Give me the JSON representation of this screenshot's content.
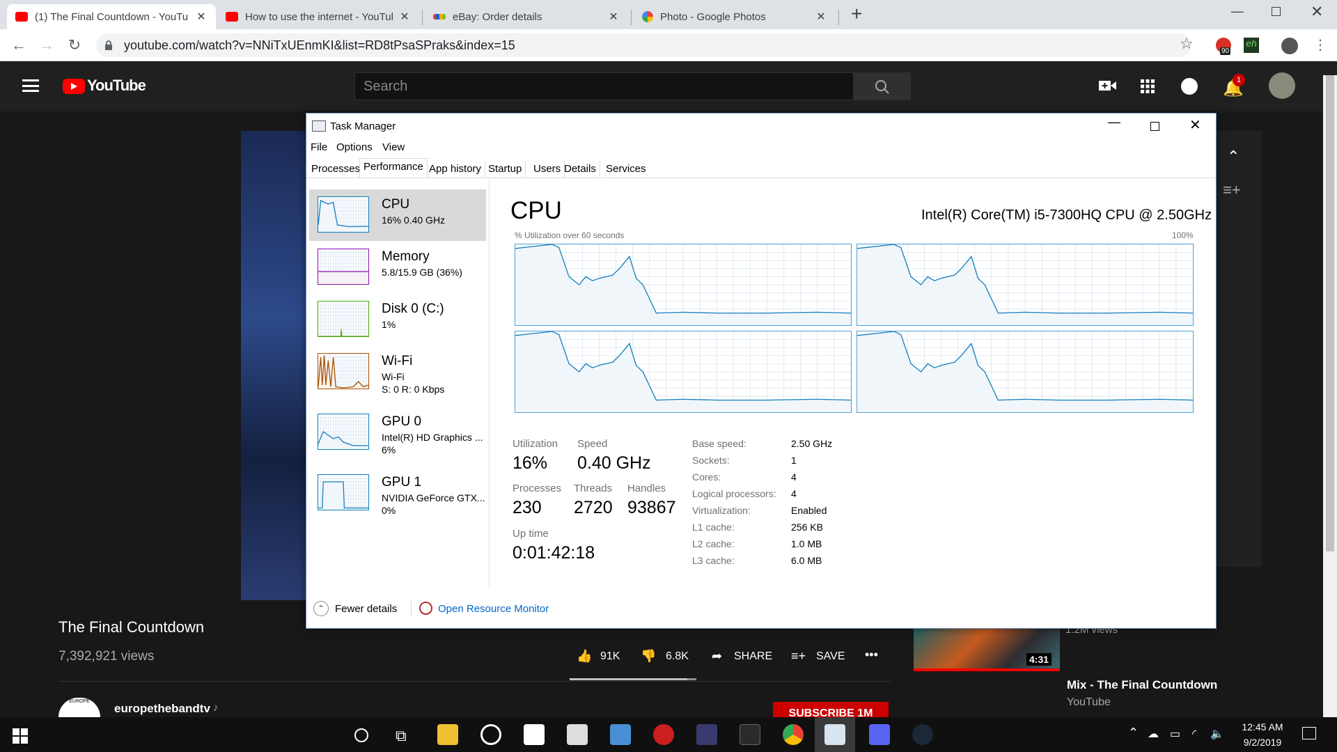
{
  "browser": {
    "tabs": [
      {
        "title": "(1) The Final Countdown - YouTu",
        "color": "#ff0000"
      },
      {
        "title": "How to use the internet - YouTub",
        "color": "#ff0000"
      },
      {
        "title": "eBay: Order details",
        "color": "#e53238"
      },
      {
        "title": "Photo - Google Photos",
        "color": "#fbbc05"
      }
    ],
    "new_tab": "+",
    "url": "youtube.com/watch?v=NNiTxUEnmKI&list=RD8tPsaSPraks&index=15",
    "ext_badge": "90",
    "ext_label": "eh"
  },
  "youtube": {
    "logo": "YouTube",
    "search_placeholder": "Search",
    "notif_count": "1",
    "video_title": "The Final Countdown",
    "views": "7,392,921 views",
    "likes": "91K",
    "dislikes": "6.8K",
    "share": "SHARE",
    "save": "SAVE",
    "channel": "europethebandtv",
    "channel_logo": "EUROPE",
    "subscribe": "SUBSCRIBE 1M",
    "side_views": "1.2M views",
    "side_duration": "4:31",
    "side_title": "Mix - The Final Countdown",
    "side_channel": "YouTube"
  },
  "taskmanager": {
    "title": "Task Manager",
    "menu": [
      "File",
      "Options",
      "View"
    ],
    "tabs": [
      "Processes",
      "Performance",
      "App history",
      "Startup",
      "Users",
      "Details",
      "Services"
    ],
    "active_tab": "Performance",
    "sidebar": [
      {
        "name": "CPU",
        "d1": "16% 0.40 GHz",
        "d2": "",
        "color": "#117dbb"
      },
      {
        "name": "Memory",
        "d1": "5.8/15.9 GB (36%)",
        "d2": "",
        "color": "#8b12ae"
      },
      {
        "name": "Disk 0 (C:)",
        "d1": "1%",
        "d2": "",
        "color": "#4da60c"
      },
      {
        "name": "Wi-Fi",
        "d1": "Wi-Fi",
        "d2": "S: 0 R: 0 Kbps",
        "color": "#a74f01"
      },
      {
        "name": "GPU 0",
        "d1": "Intel(R) HD Graphics ...",
        "d2": "6%",
        "color": "#117dbb"
      },
      {
        "name": "GPU 1",
        "d1": "NVIDIA GeForce GTX...",
        "d2": "0%",
        "color": "#117dbb"
      }
    ],
    "cpu": {
      "heading": "CPU",
      "model": "Intel(R) Core(TM) i5-7300HQ CPU @ 2.50GHz",
      "graph_label": "% Utilization over 60 seconds",
      "graph_max": "100%",
      "utilization_label": "Utilization",
      "utilization": "16%",
      "speed_label": "Speed",
      "speed": "0.40 GHz",
      "processes_label": "Processes",
      "processes": "230",
      "threads_label": "Threads",
      "threads": "2720",
      "handles_label": "Handles",
      "handles": "93867",
      "uptime_label": "Up time",
      "uptime": "0:01:42:18",
      "props": [
        {
          "k": "Base speed:",
          "v": "2.50 GHz"
        },
        {
          "k": "Sockets:",
          "v": "1"
        },
        {
          "k": "Cores:",
          "v": "4"
        },
        {
          "k": "Logical processors:",
          "v": "4"
        },
        {
          "k": "Virtualization:",
          "v": "Enabled"
        },
        {
          "k": "L1 cache:",
          "v": "256 KB"
        },
        {
          "k": "L2 cache:",
          "v": "1.0 MB"
        },
        {
          "k": "L3 cache:",
          "v": "6.0 MB"
        }
      ]
    },
    "fewer_details": "Fewer details",
    "open_resmon": "Open Resource Monitor"
  },
  "taskbar": {
    "time": "12:45 AM",
    "date": "9/2/2019"
  }
}
